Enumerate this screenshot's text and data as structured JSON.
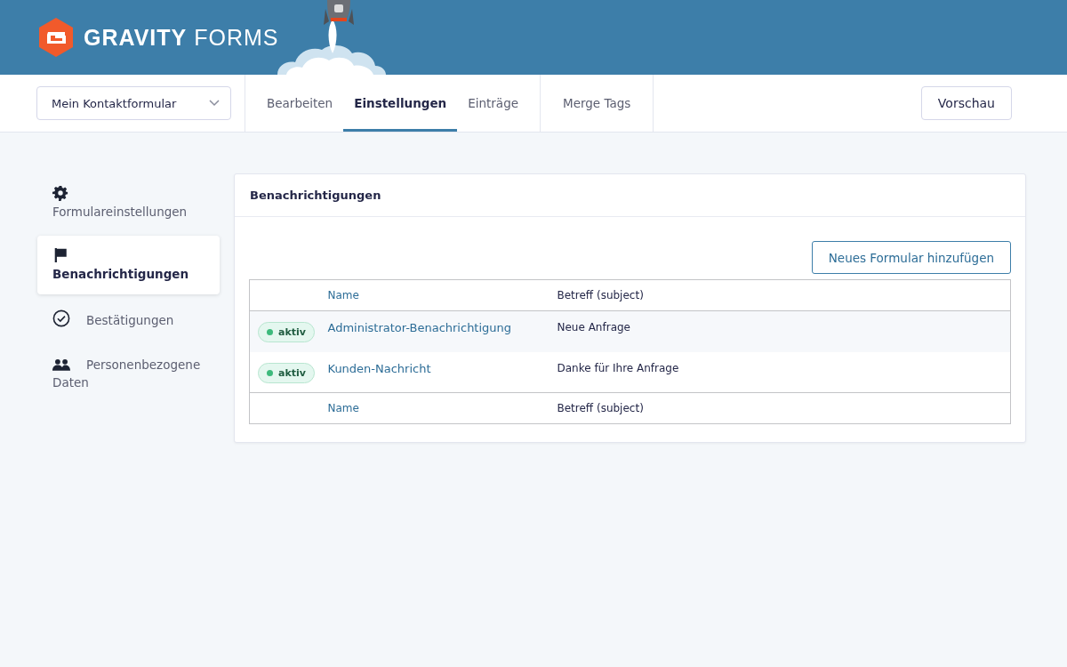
{
  "header": {
    "logo_bold": "GRAVITY",
    "logo_light": "FORMS"
  },
  "toolbar": {
    "form_select": "Mein Kontaktformular",
    "tabs": [
      {
        "label": "Bearbeiten",
        "selected": false
      },
      {
        "label": "Einstellungen",
        "selected": true
      },
      {
        "label": "Einträge",
        "selected": false
      }
    ],
    "merge_tags": "Merge Tags",
    "preview_button": "Vorschau"
  },
  "sidebar": {
    "items": [
      {
        "kind": "gear",
        "label": "Formulareinstellungen",
        "selected": false
      },
      {
        "kind": "flag",
        "label": "Benachrichtigungen",
        "selected": true
      },
      {
        "kind": "check",
        "label": "Bestätigungen",
        "selected": false
      },
      {
        "kind": "people",
        "label": "Personenbezogene Daten",
        "selected": false
      }
    ]
  },
  "panel": {
    "title": "Benachrichtigungen",
    "add_button": "Neues Formular hinzufügen",
    "table": {
      "columns": [
        "Name",
        "Betreff (subject)"
      ],
      "rows": [
        {
          "status": "aktiv",
          "active": true,
          "name": "Administrator-Benachrichtigung",
          "subject": "Neue Anfrage"
        },
        {
          "status": "aktiv",
          "active": true,
          "name": "Kunden-Nachricht",
          "subject": "Danke für Ihre Anfrage"
        }
      ],
      "footer_columns": [
        "Name",
        "Betreff (subject)"
      ]
    }
  }
}
